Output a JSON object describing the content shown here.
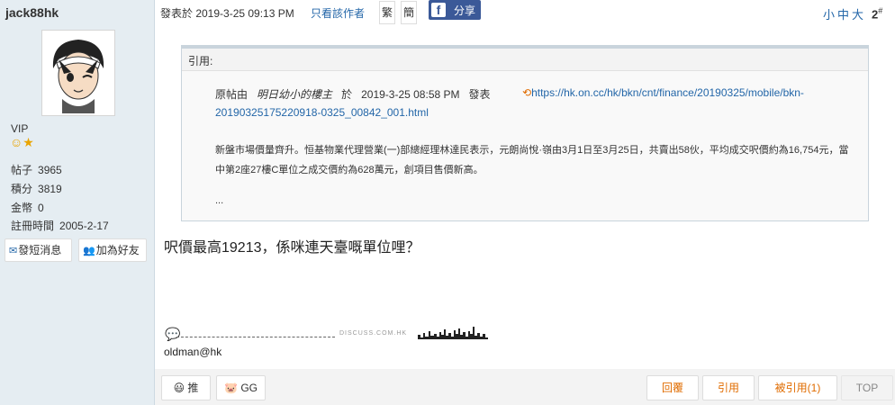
{
  "user": {
    "name": "jack88hk",
    "level": "VIP",
    "stats": [
      {
        "label": "帖子",
        "value": "3965"
      },
      {
        "label": "積分",
        "value": "3819"
      },
      {
        "label": "金幣",
        "value": "0"
      },
      {
        "label": "註冊時間",
        "value": "2005-2-17"
      }
    ],
    "actions": {
      "message": "發短消息",
      "add_friend": "加為好友"
    }
  },
  "header": {
    "posted_at": "發表於 2019-3-25 09:13 PM",
    "only_author": "只看該作者",
    "traditional": "繁",
    "simplified": "簡",
    "share": "分享",
    "font_sizes": "小中大",
    "floor": "2",
    "floor_mark": "#"
  },
  "quote": {
    "label": "引用:",
    "original_prefix": "原帖由",
    "original_author": "明日幼小的樓主",
    "at": "於",
    "time": "2019-3-25  08:58  PM",
    "posted": "發表",
    "url_part1": "https://hk.on.cc/hk/bkn/cnt/finance/20190325/mobile/bkn-",
    "url_part2": "20190325175220918-0325_00842_001.html",
    "paragraph": "新盤市場價量齊升。恒基物業代理營業(一)部總經理林達民表示，元朗尚悅·嶺由3月1日至3月25日，共賣出58伙，平均成交呎價約為16,754元，當中第2座27樓C單位之成交價約為628萬元，創項目售價新高。",
    "ellipsis": "..."
  },
  "post": {
    "text": "呎價最高19213，係咪連天臺嘅單位哩？"
  },
  "signature": {
    "watermark": "DISCUSS.COM.HK",
    "name": "oldman@hk"
  },
  "bottom": {
    "push": "推",
    "gg": "GG",
    "reply": "回覆",
    "quote": "引用",
    "quoted": "被引用(1)",
    "top": "TOP"
  },
  "colors": {
    "sidebar_bg": "#e5edf2",
    "link": "#2366a8",
    "action_orange": "#e06c00",
    "facebook": "#3b5998"
  }
}
